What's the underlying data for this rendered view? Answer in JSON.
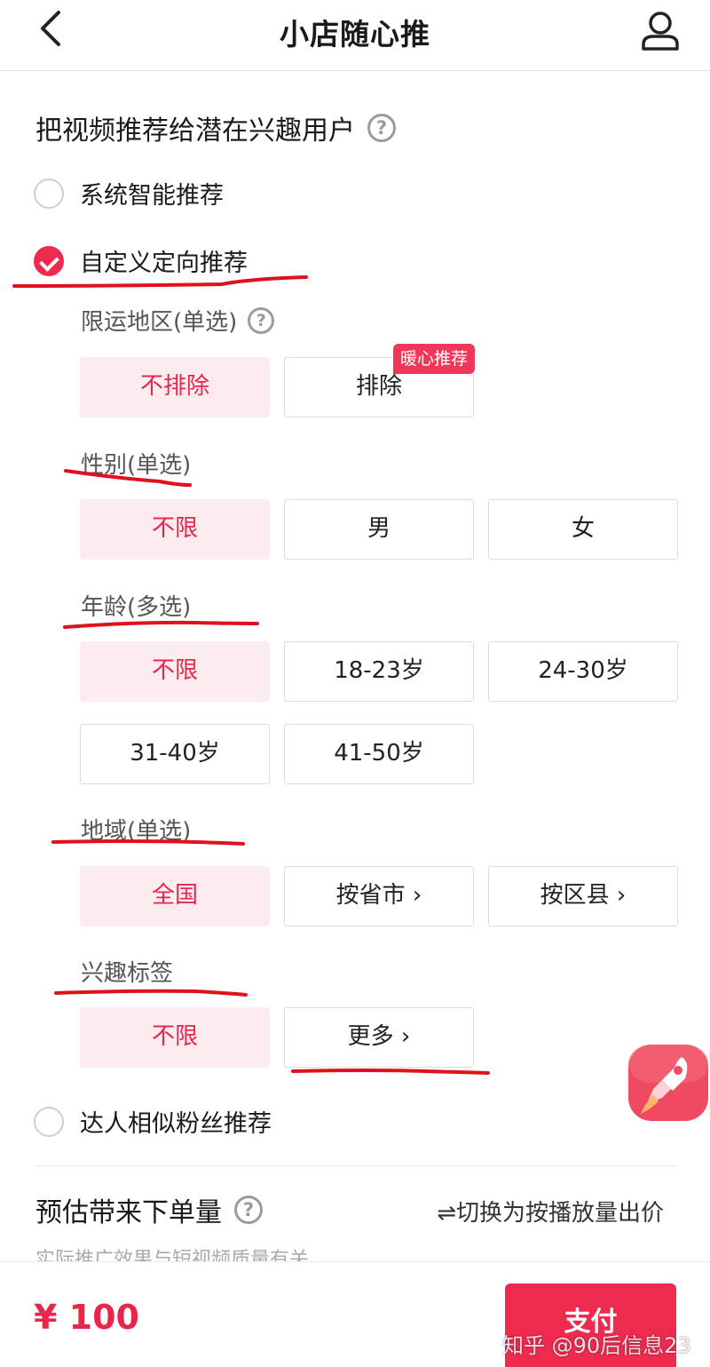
{
  "header": {
    "title": "小店随心推"
  },
  "targeting": {
    "title": "把视频推荐给潜在兴趣用户",
    "option_system": "系统智能推荐",
    "option_custom": "自定义定向推荐",
    "option_creator": "达人相似粉丝推荐"
  },
  "restricted_region": {
    "label": "限运地区(单选)",
    "options": [
      "不排除",
      "排除"
    ],
    "badge": "暖心推荐",
    "selected": "不排除"
  },
  "gender": {
    "label": "性别(单选)",
    "options": [
      "不限",
      "男",
      "女"
    ],
    "selected": "不限"
  },
  "age": {
    "label": "年龄(多选)",
    "options": [
      "不限",
      "18-23岁",
      "24-30岁",
      "31-40岁",
      "41-50岁"
    ],
    "selected": "不限"
  },
  "region": {
    "label": "地域(单选)",
    "options": [
      "全国",
      "按省市 ›",
      "按区县 ›"
    ],
    "selected": "全国"
  },
  "interest": {
    "label": "兴趣标签",
    "options": [
      "不限",
      "更多 ›"
    ],
    "selected": "不限"
  },
  "estimate": {
    "title": "预估带来下单量",
    "switch_label": "⇌切换为按播放量出价",
    "note": "实际推广效果与短视频质量有关"
  },
  "footer": {
    "price": "¥ 100",
    "pay_label": "支付",
    "watermark": "知乎 @90后信息23"
  },
  "colors": {
    "accent": "#ee2a4f",
    "selected_bg": "#fdecef",
    "annotation": "#e0101c"
  }
}
